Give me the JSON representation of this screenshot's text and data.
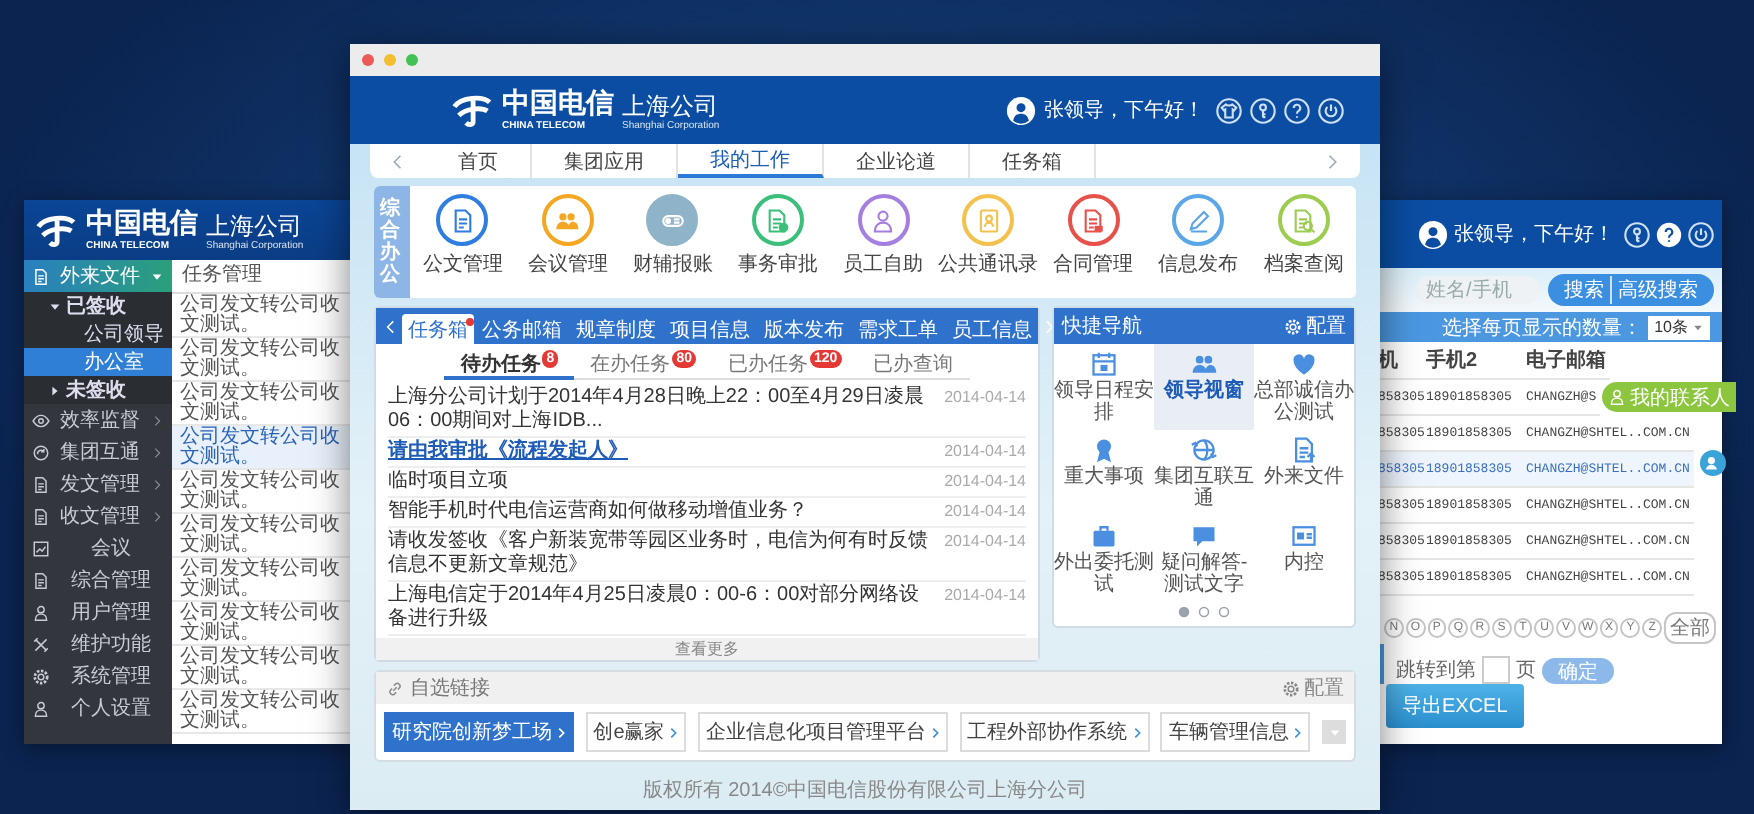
{
  "left_window": {
    "logo": {
      "brand": "中国电信",
      "brand_en": "CHINA TELECOM",
      "branch": "上海公司",
      "branch_en": "Shanghai Corporation"
    },
    "sidebar": {
      "section": {
        "label": "外来文件",
        "expanded": true
      },
      "tree": [
        {
          "label": "已签收",
          "expanded": true,
          "children": [
            {
              "label": "公司领导",
              "selected": false
            },
            {
              "label": "办公室",
              "selected": true
            }
          ]
        },
        {
          "label": "未签收",
          "expanded": false
        }
      ],
      "items": [
        {
          "label": "效率监督",
          "submenu": true
        },
        {
          "label": "集团互通",
          "submenu": true
        },
        {
          "label": "发文管理",
          "submenu": true
        },
        {
          "label": "收文管理",
          "submenu": true
        },
        {
          "label": "会议",
          "submenu": false
        },
        {
          "label": "综合管理",
          "submenu": false
        },
        {
          "label": "用户管理",
          "submenu": false
        },
        {
          "label": "维护功能",
          "submenu": false
        },
        {
          "label": "系统管理",
          "submenu": false
        },
        {
          "label": "个人设置",
          "submenu": false
        }
      ]
    },
    "panel_title": "任务管理",
    "rows": [
      {
        "text": "公司发文转公司收文测试。",
        "selected": false
      },
      {
        "text": "公司发文转公司收文测试。",
        "selected": false
      },
      {
        "text": "公司发文转公司收文测试。",
        "selected": false
      },
      {
        "text": "公司发文转公司收文测试。",
        "selected": true
      },
      {
        "text": "公司发文转公司收文测试。",
        "selected": false
      },
      {
        "text": "公司发文转公司收文测试。",
        "selected": false
      },
      {
        "text": "公司发文转公司收文测试。",
        "selected": false
      },
      {
        "text": "公司发文转公司收文测试。",
        "selected": false
      },
      {
        "text": "公司发文转公司收文测试。",
        "selected": false
      },
      {
        "text": "公司发文转公司收文测试。",
        "selected": false
      }
    ]
  },
  "center_window": {
    "logo": {
      "brand": "中国电信",
      "brand_en": "CHINA TELECOM",
      "branch": "上海公司",
      "branch_en": "Shanghai Corporation"
    },
    "greeting": "张领导，下午好！",
    "nav": [
      {
        "label": "首页",
        "selected": false
      },
      {
        "label": "集团应用",
        "selected": false
      },
      {
        "label": "我的工作",
        "selected": true
      },
      {
        "label": "企业论道",
        "selected": false
      },
      {
        "label": "任务箱",
        "selected": false
      }
    ],
    "office": {
      "title": "综合办公",
      "items": [
        {
          "label": "公文管理",
          "color": "#2f7de1",
          "selected": false
        },
        {
          "label": "会议管理",
          "color": "#f5a623",
          "selected": false
        },
        {
          "label": "财辅报账",
          "color": "#8fb3c8",
          "selected": true
        },
        {
          "label": "事务审批",
          "color": "#3cbf7a",
          "selected": false
        },
        {
          "label": "员工自助",
          "color": "#a57fe0",
          "selected": false
        },
        {
          "label": "公共通讯录",
          "color": "#f2c14e",
          "selected": false
        },
        {
          "label": "合同管理",
          "color": "#e8504a",
          "selected": false
        },
        {
          "label": "信息发布",
          "color": "#5aa6e6",
          "selected": false
        },
        {
          "label": "档案查阅",
          "color": "#9ccc50",
          "selected": false
        }
      ]
    },
    "tasks": {
      "tabs": [
        {
          "label": "任务箱",
          "selected": true,
          "unread": true
        },
        {
          "label": "公务邮箱",
          "selected": false,
          "unread": false
        },
        {
          "label": "规章制度",
          "selected": false,
          "unread": false
        },
        {
          "label": "项目信息",
          "selected": false,
          "unread": false
        },
        {
          "label": "版本发布",
          "selected": false,
          "unread": false
        },
        {
          "label": "需求工单",
          "selected": false,
          "unread": false
        },
        {
          "label": "员工信息",
          "selected": false,
          "unread": false
        }
      ],
      "subtabs": [
        {
          "label": "待办任务",
          "badge": "8",
          "selected": true
        },
        {
          "label": "在办任务",
          "badge": "80",
          "selected": false
        },
        {
          "label": "已办任务",
          "badge": "120",
          "selected": false
        },
        {
          "label": "已办查询",
          "selected": false
        }
      ],
      "items": [
        {
          "kind": "text",
          "text": "上海分公司计划于2014年4月28日晚上22：00至4月29日凌晨06：00期间对上海IDB...",
          "date": "2014-04-14"
        },
        {
          "kind": "link",
          "text": "请由我审批《流程发起人》",
          "date": "2014-04-14"
        },
        {
          "kind": "text",
          "text": "临时项目立项",
          "date": "2014-04-14"
        },
        {
          "kind": "text",
          "text": "智能手机时代电信运营商如何做移动增值业务？",
          "date": "2014-04-14"
        },
        {
          "kind": "text",
          "text": "请收发签收《客户新装宽带等园区业务时，电信为何有时反馈信息不更新文章规范》",
          "date": "2014-04-14"
        },
        {
          "kind": "text",
          "text": "上海电信定于2014年4月25日凌晨0：00-6：00对部分网络设备进行升级",
          "date": "2014-04-14"
        }
      ],
      "more": "查看更多"
    },
    "quick_nav": {
      "title": "快捷导航",
      "config": "配置",
      "items": [
        {
          "label": "领导日程安排",
          "selected": false
        },
        {
          "label": "领导视窗",
          "selected": true
        },
        {
          "label": "总部诚信办公测试",
          "selected": false
        },
        {
          "label": "重大事项",
          "selected": false
        },
        {
          "label": "集团互联互通",
          "selected": false
        },
        {
          "label": "外来文件",
          "selected": false
        },
        {
          "label": "外出委托测试",
          "selected": false
        },
        {
          "label": "疑问解答-测试文字",
          "selected": false
        },
        {
          "label": "内控",
          "selected": false
        }
      ],
      "pages": [
        {
          "selected": true
        },
        {
          "selected": false
        },
        {
          "selected": false
        }
      ]
    },
    "links": {
      "title": "自选链接",
      "config": "配置",
      "items": [
        {
          "label": "研究院创新梦工场",
          "selected": true
        },
        {
          "label": "创e赢家",
          "selected": false
        },
        {
          "label": "企业信息化项目管理平台",
          "selected": false
        },
        {
          "label": "工程外部协作系统",
          "selected": false
        },
        {
          "label": "车辆管理信息",
          "selected": false
        }
      ]
    },
    "footer": "版权所有 2014©中国电信股份有限公司上海分公司"
  },
  "right_window": {
    "greeting": "张领导，下午好！",
    "search": {
      "placeholder": "姓名/手机"
    },
    "search_button": "搜索",
    "advanced_button": "高级搜索",
    "page_size_label": "选择每页显示的数量：",
    "page_size": "10条",
    "columns": [
      "机",
      "手机2",
      "电子邮箱"
    ],
    "rows": [
      {
        "cells": [
          "858305",
          "18901858305",
          "CHANGZH@S"
        ],
        "selected": false
      },
      {
        "cells": [
          "858305",
          "18901858305",
          "CHANGZH@SHTEL..COM.CN"
        ],
        "selected": false
      },
      {
        "cells": [
          "858305",
          "18901858305",
          "CHANGZH@SHTEL..COM.CN"
        ],
        "selected": true
      },
      {
        "cells": [
          "858305",
          "18901858305",
          "CHANGZH@SHTEL..COM.CN"
        ],
        "selected": false
      },
      {
        "cells": [
          "858305",
          "18901858305",
          "CHANGZH@SHTEL..COM.CN"
        ],
        "selected": false
      },
      {
        "cells": [
          "858305",
          "18901858305",
          "CHANGZH@SHTEL..COM.CN"
        ],
        "selected": false
      }
    ],
    "contacts": "我的联系人",
    "letters": [
      "N",
      "O",
      "P",
      "Q",
      "R",
      "S",
      "T",
      "U",
      "V",
      "W",
      "X",
      "Y",
      "Z"
    ],
    "all_letters": "全部",
    "jump_label": "跳转到第",
    "page_unit": "页",
    "confirm": "确定",
    "export": "导出EXCEL"
  }
}
